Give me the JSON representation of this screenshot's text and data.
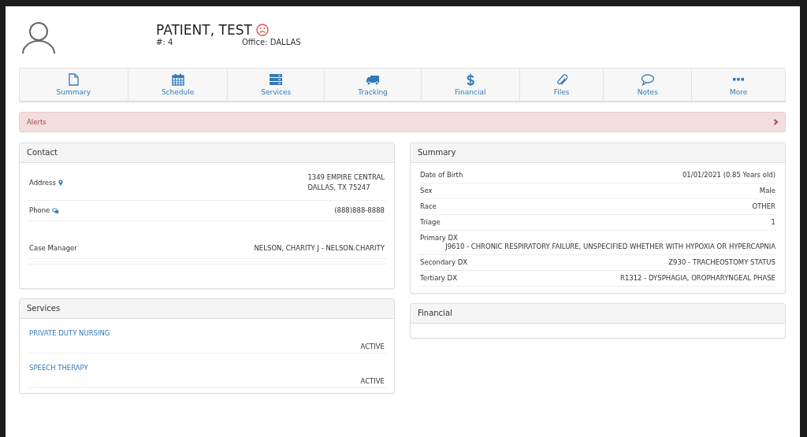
{
  "patient": {
    "name": "PATIENT, TEST",
    "number": "#: 4",
    "office": "Office: DALLAS"
  },
  "nav_tabs": [
    {
      "label": "Summary",
      "kind": "file"
    },
    {
      "label": "Schedule",
      "kind": "calendar"
    },
    {
      "label": "Services",
      "kind": "server"
    },
    {
      "label": "Tracking",
      "kind": "truck"
    },
    {
      "label": "Financial",
      "kind": "dollar"
    },
    {
      "label": "Files",
      "kind": "paperclip"
    },
    {
      "label": "Notes",
      "kind": "comment"
    },
    {
      "label": "More",
      "kind": "ellipsis"
    }
  ],
  "alerts": {
    "label": "Alerts"
  },
  "contact": {
    "title": "Contact",
    "rows": [
      {
        "label": "Address",
        "kind": "address",
        "value": [
          "1349 EMPIRE CENTRAL",
          "DALLAS, TX 75247"
        ]
      },
      {
        "label": "Phone",
        "kind": "phone",
        "value": [
          "(888)888-8888"
        ]
      },
      {
        "label": "Case Manager",
        "kind": "plain",
        "value": [
          "NELSON, CHARITY J - NELSON.CHARITY"
        ]
      }
    ]
  },
  "summary": {
    "title": "Summary",
    "rows": [
      {
        "label": "Date of Birth",
        "value": "01/01/2021 (0.85 Years old)",
        "kind": "inline"
      },
      {
        "label": "Sex",
        "value": "Male",
        "kind": "inline"
      },
      {
        "label": "Race",
        "value": "OTHER",
        "kind": "inline"
      },
      {
        "label": "Triage",
        "value": "1",
        "kind": "inline"
      },
      {
        "label": "Primary DX",
        "value": "J9610 - CHRONIC RESPIRATORY FAILURE, UNSPECIFIED WHETHER WITH HYPOXIA OR HYPERCAPNIA",
        "kind": "stacked"
      },
      {
        "label": "Secondary DX",
        "value": "Z930 - TRACHEOSTOMY STATUS",
        "kind": "inline"
      },
      {
        "label": "Tertiary DX",
        "value": "R1312 - DYSPHAGIA, OROPHARYNGEAL PHASE",
        "kind": "inline"
      }
    ]
  },
  "services": {
    "title": "Services",
    "items": [
      {
        "name": "PRIVATE DUTY NURSING",
        "status": "ACTIVE"
      },
      {
        "name": "SPEECH THERAPY",
        "status": "ACTIVE"
      }
    ]
  },
  "financial": {
    "title": "Financial"
  }
}
